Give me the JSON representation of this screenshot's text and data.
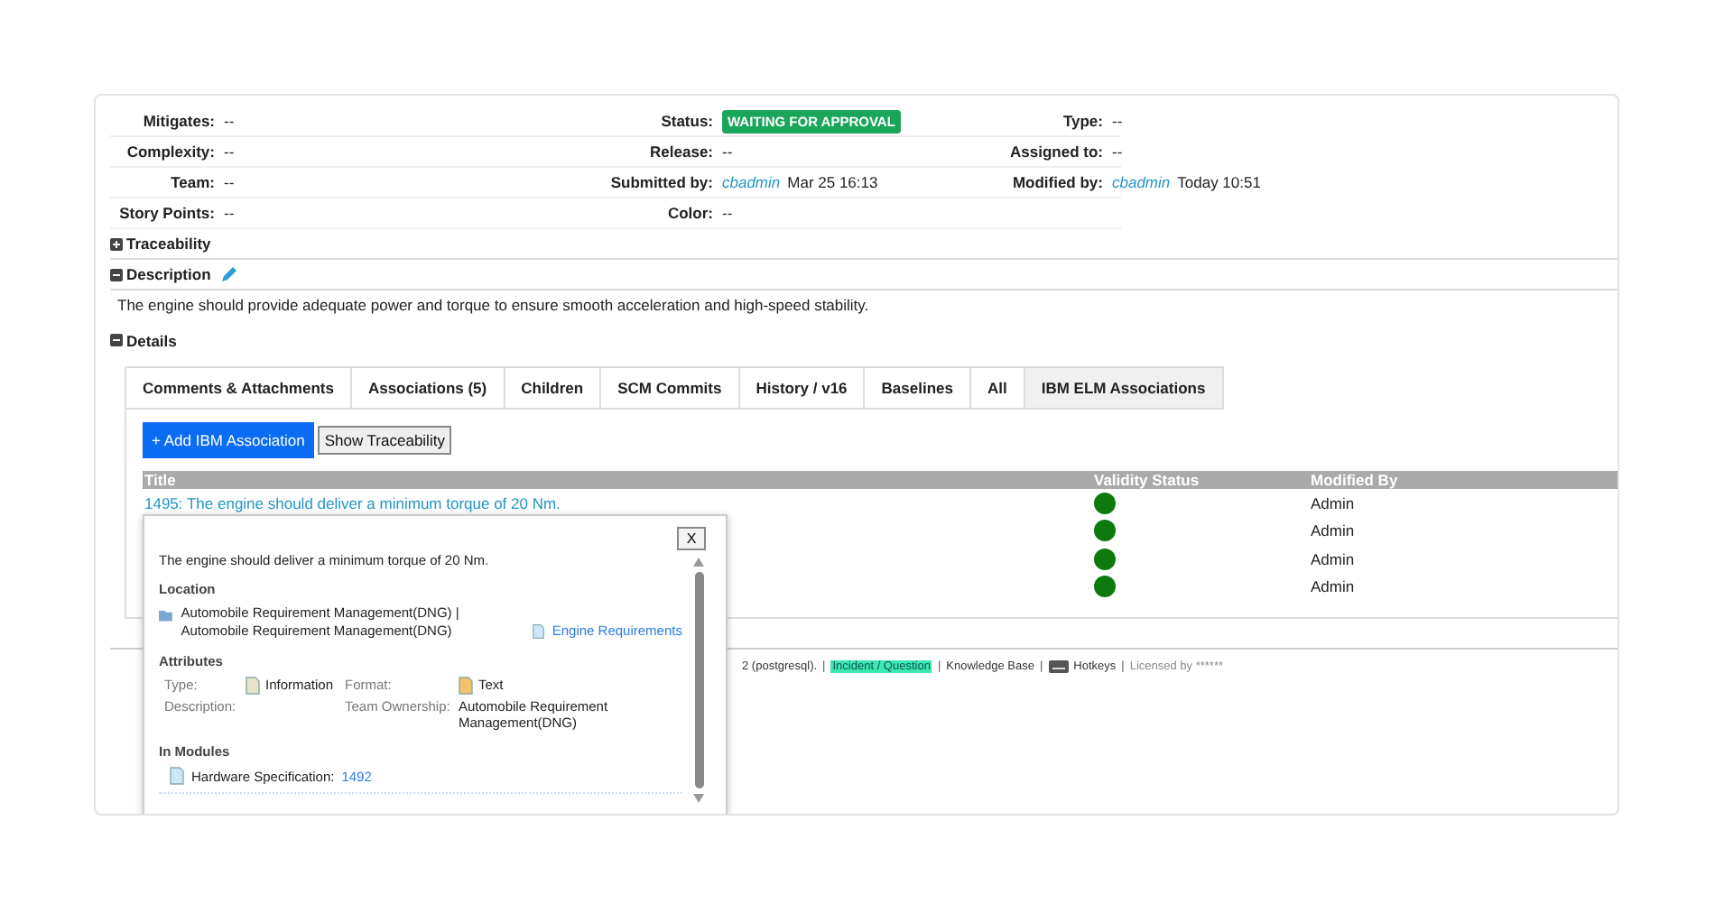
{
  "fields": [
    [
      {
        "label": "Mitigates:",
        "kind": "text",
        "value": "--"
      },
      {
        "label": "Status:",
        "kind": "badge",
        "value": "WAITING FOR APPROVAL"
      },
      {
        "label": "Type:",
        "kind": "text",
        "value": "--"
      }
    ],
    [
      {
        "label": "Complexity:",
        "kind": "text",
        "value": "--"
      },
      {
        "label": "Release:",
        "kind": "text",
        "value": "--"
      },
      {
        "label": "Assigned to:",
        "kind": "text",
        "value": "--"
      }
    ],
    [
      {
        "label": "Team:",
        "kind": "text",
        "value": "--"
      },
      {
        "label": "Submitted by:",
        "kind": "user",
        "user": "cbadmin",
        "value": "Mar 25 16:13"
      },
      {
        "label": "Modified by:",
        "kind": "user",
        "user": "cbadmin",
        "value": "Today 10:51"
      }
    ],
    [
      {
        "label": "Story Points:",
        "kind": "text",
        "value": "--"
      },
      {
        "label": "Color:",
        "kind": "text",
        "value": "--"
      }
    ]
  ],
  "sections": [
    {
      "title": "Traceability",
      "expanded": false,
      "editable": false
    },
    {
      "title": "Description",
      "expanded": true,
      "editable": true,
      "text": "The engine should provide adequate power and torque to ensure smooth acceleration and high-speed stability."
    },
    {
      "title": "Details",
      "expanded": true,
      "editable": false
    }
  ],
  "tabs": [
    {
      "label": "Comments & Attachments",
      "selected": false
    },
    {
      "label": "Associations (5)",
      "selected": false
    },
    {
      "label": "Children",
      "selected": false
    },
    {
      "label": "SCM Commits",
      "selected": false
    },
    {
      "label": "History / v16",
      "selected": false
    },
    {
      "label": "Baselines",
      "selected": false
    },
    {
      "label": "All",
      "selected": false
    },
    {
      "label": "IBM ELM Associations",
      "selected": true
    }
  ],
  "buttons": [
    {
      "label": "+ Add IBM Association",
      "kind": "primary"
    },
    {
      "label": "Show Traceability",
      "kind": "plain"
    }
  ],
  "table": {
    "columns": [
      "Title",
      "Validity Status",
      "Modified By"
    ],
    "rows": [
      {
        "title": "1495: The engine should deliver a minimum torque of 20 Nm.",
        "color": "#0e7a0e",
        "modified_by": "Admin"
      },
      {
        "color": "#0e7a0e",
        "modified_by": "Admin"
      },
      {
        "color": "#0e7a0e",
        "modified_by": "Admin"
      },
      {
        "color": "#0e7a0e",
        "modified_by": "Admin"
      }
    ]
  },
  "footer": {
    "separator": "|",
    "items": [
      {
        "kind": "text",
        "text": "2 (postgresql)."
      },
      {
        "kind": "highlight",
        "text": "Incident / Question"
      },
      {
        "kind": "text",
        "text": "Knowledge Base"
      },
      {
        "kind": "hotkey",
        "text": "Hotkeys"
      },
      {
        "kind": "muted",
        "text": "Licensed by ******"
      }
    ]
  },
  "popup": {
    "close": "X",
    "summary": "The engine should deliver a minimum torque of 20 Nm.",
    "location_heading": "Location",
    "location_path": "Automobile Requirement Management(DNG) | Automobile Requirement Management(DNG)",
    "location_link": "Engine Requirements",
    "attributes_heading": "Attributes",
    "attributes": [
      {
        "label": "Type:",
        "value": "Information"
      },
      {
        "label": "Format:",
        "value": "Text"
      },
      {
        "label": "Description:"
      },
      {
        "label": "Team Ownership:",
        "value": "Automobile Requirement Management(DNG)"
      }
    ],
    "modules_heading": "In Modules",
    "modules": [
      {
        "name": "Hardware Specification:",
        "link": "1492"
      }
    ]
  }
}
